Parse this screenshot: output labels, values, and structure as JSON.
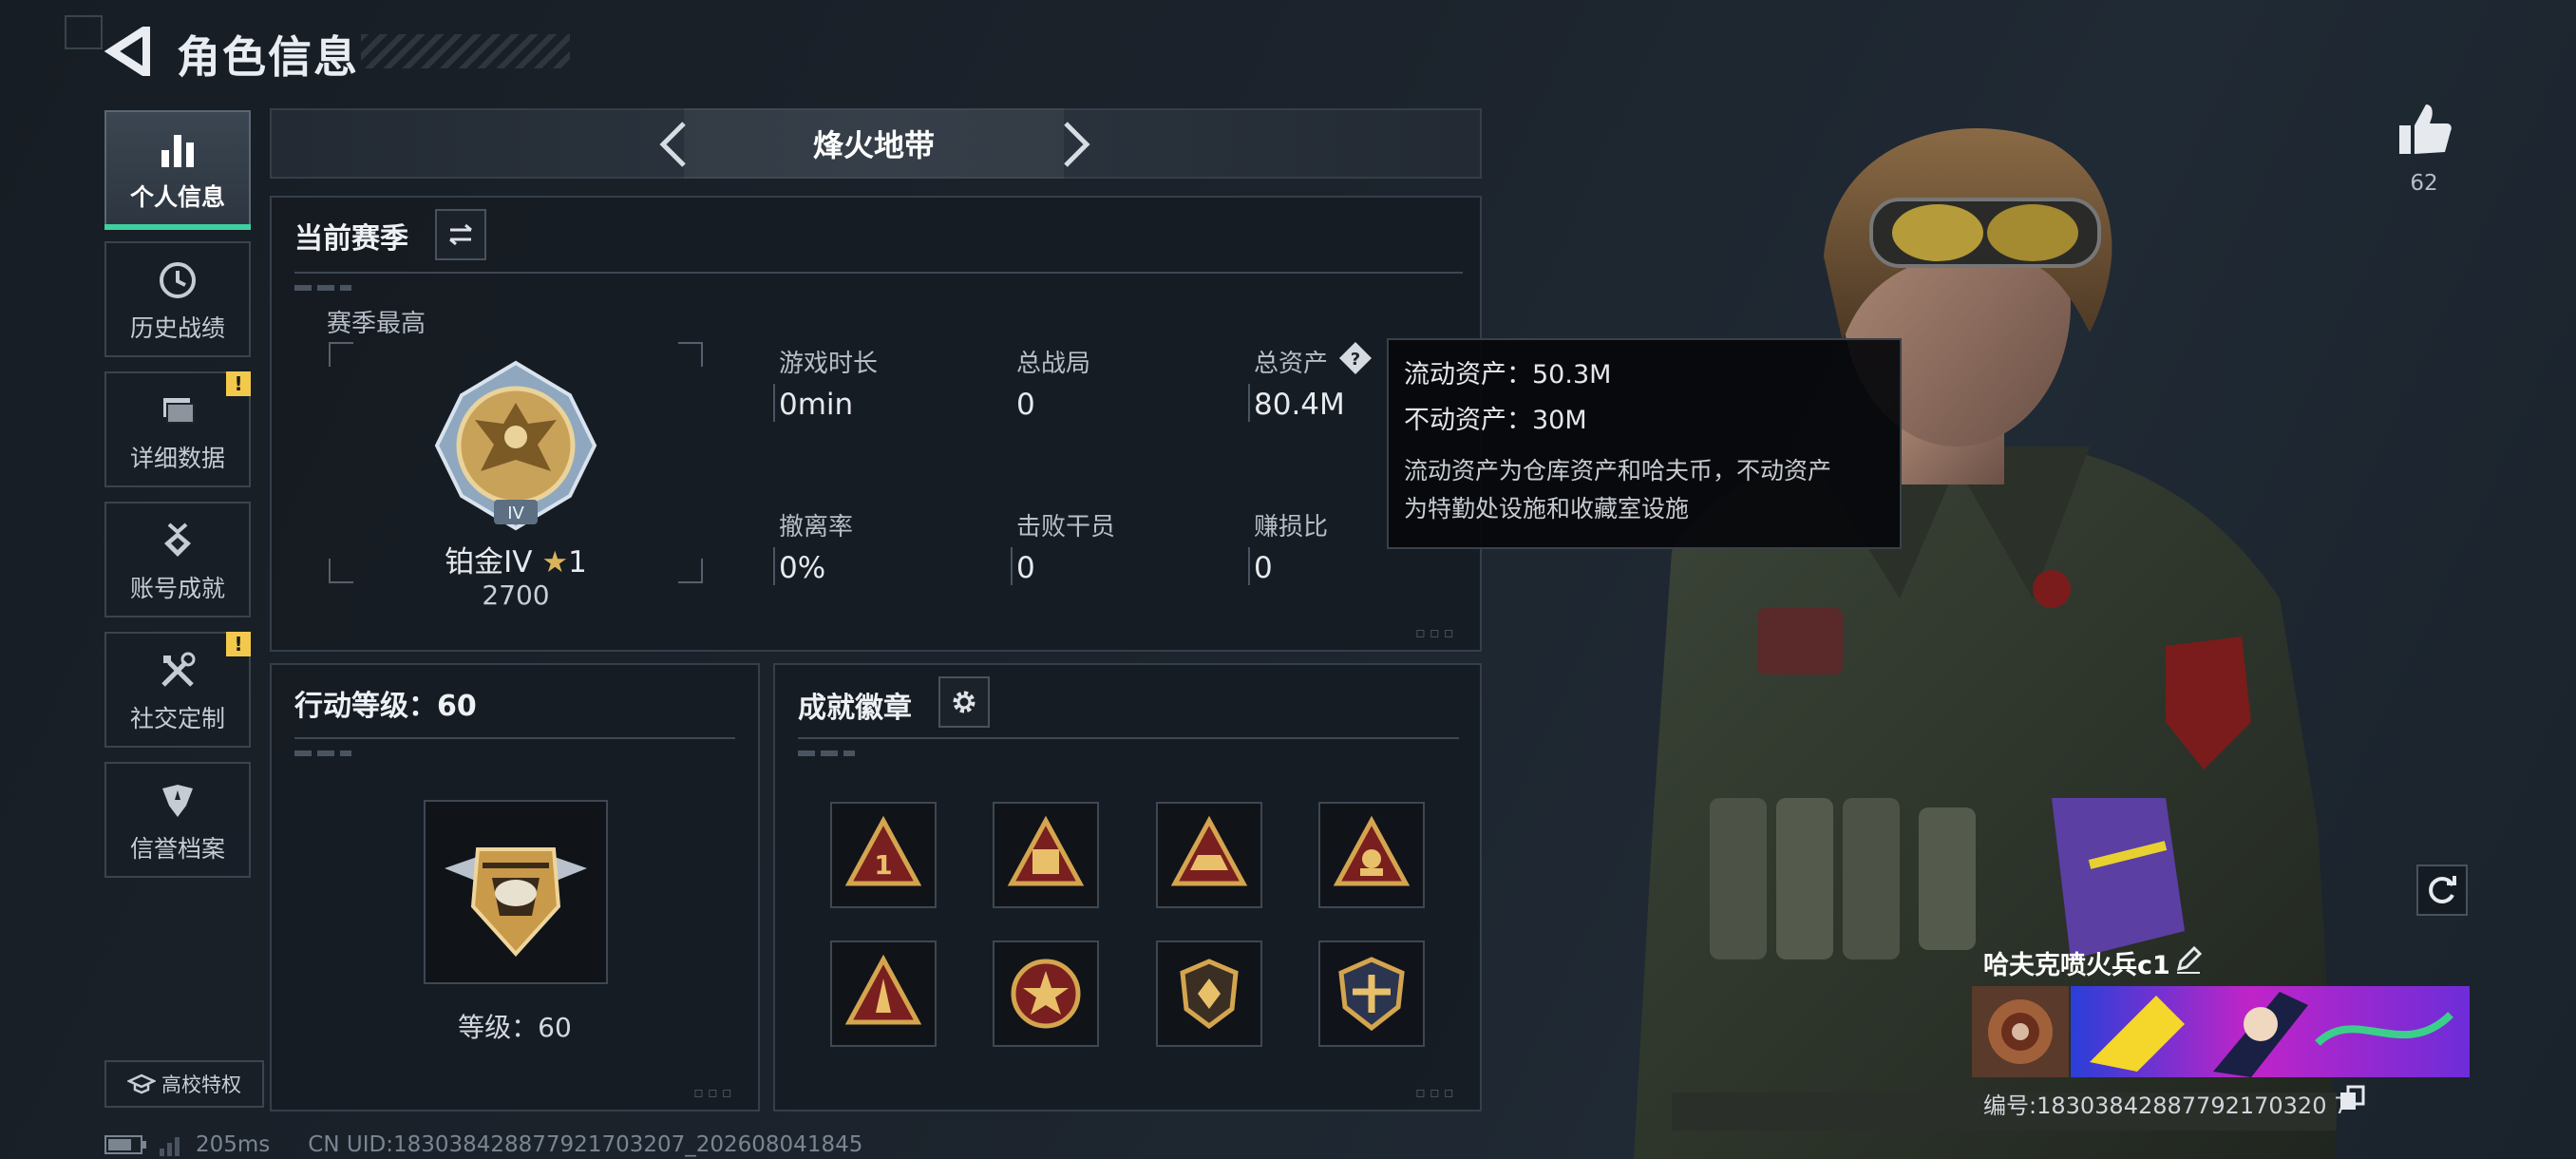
{
  "header": {
    "title": "角色信息"
  },
  "tabs": [
    {
      "label": "个人信息",
      "icon": "bar-chart-icon",
      "active": true,
      "alert": false
    },
    {
      "label": "历史战绩",
      "icon": "clock-icon",
      "active": false,
      "alert": false
    },
    {
      "label": "详细数据",
      "icon": "folder-icon",
      "active": false,
      "alert": true
    },
    {
      "label": "账号成就",
      "icon": "medal-icon",
      "active": false,
      "alert": false
    },
    {
      "label": "社交定制",
      "icon": "tools-icon",
      "active": false,
      "alert": true
    },
    {
      "label": "信誉档案",
      "icon": "shield-icon",
      "active": false,
      "alert": false
    }
  ],
  "tab_alert_symbol": "!",
  "school_label": "高校特权",
  "mode": {
    "name": "烽火地带"
  },
  "season_panel": {
    "title": "当前赛季",
    "best_label": "赛季最高",
    "rank_name": "铂金IV",
    "rank_stars": "1",
    "rank_score": "2700",
    "rank_emblem_text": "IV",
    "stats": [
      {
        "label": "游戏时长",
        "value": "0min"
      },
      {
        "label": "总战局",
        "value": "0"
      },
      {
        "label": "总资产",
        "value": "80.4M"
      },
      {
        "label": "撤离率",
        "value": "0%"
      },
      {
        "label": "击败干员",
        "value": "0"
      },
      {
        "label": "赚损比",
        "value": "0"
      }
    ]
  },
  "tooltip": {
    "liquid": "流动资产：50.3M",
    "fixed": "不动资产：30M",
    "desc_line1": "流动资产为仓库资产和哈夫币，不动资产",
    "desc_line2": "为特勤处设施和收藏室设施"
  },
  "level_panel": {
    "title": "行动等级：60",
    "level_text": "等级：60"
  },
  "badge_panel": {
    "title": "成就徽章",
    "badges": [
      "badge-1-icon",
      "badge-2-icon",
      "badge-3-icon",
      "badge-4-icon",
      "badge-5-icon",
      "badge-6-icon",
      "badge-7-icon",
      "badge-8-icon"
    ]
  },
  "profile": {
    "likes": "62",
    "name": "哈夫克喷火兵c1",
    "id_text": "编号:18303842887792170320 7"
  },
  "status": {
    "ping": "205ms",
    "uid": "CN UID:183038428877921703207_202608041845"
  },
  "colors": {
    "accent": "#3fd0a0",
    "alert": "#f2c94c",
    "gold": "#c9a25a"
  }
}
